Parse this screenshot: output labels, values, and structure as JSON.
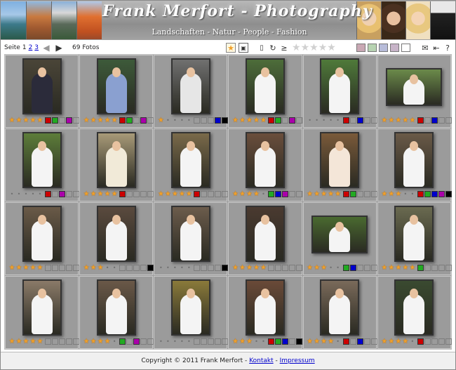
{
  "header": {
    "title": "Frank Merfort - Photography",
    "subtitle": "Landschaften - Natur - People - Fashion"
  },
  "toolbar": {
    "page_label": "Seite",
    "pages": [
      "1",
      "2",
      "3"
    ],
    "current_page": "1",
    "photo_count": "69 Fotos",
    "color_filters": [
      "#c9a8b4",
      "#b7d3b2",
      "#b7bcd9",
      "#c7b4c8",
      "#ffffff"
    ]
  },
  "cells": [
    {
      "orient": "portrait",
      "dress": "#2b2b3a",
      "bg": "#4a4538",
      "rating": 5,
      "squares": [
        "#cc0000",
        "#22aa22",
        "",
        "#aa00aa",
        ""
      ]
    },
    {
      "orient": "portrait",
      "dress": "#8aa0d0",
      "bg": "#3d5a3a",
      "rating": 5,
      "squares": [
        "#cc0000",
        "#22aa22",
        "",
        "#aa00aa",
        ""
      ]
    },
    {
      "orient": "portrait",
      "dress": "#e6e6e6",
      "bg": "#707070",
      "rating": 1,
      "squares": [
        "",
        "",
        "",
        "#0000cc",
        "#000000"
      ]
    },
    {
      "orient": "portrait",
      "dress": "#f4f4f4",
      "bg": "#4d6d3a",
      "rating": 5,
      "squares": [
        "#cc0000",
        "#22aa22",
        "",
        "#aa00aa",
        ""
      ]
    },
    {
      "orient": "portrait",
      "dress": "#f4f4f4",
      "bg": "#4f7a3a",
      "rating": 0,
      "squares": [
        "#cc0000",
        "",
        "#0000cc",
        "",
        ""
      ]
    },
    {
      "orient": "landscape",
      "dress": "#f4f4f4",
      "bg": "#6b8a4a",
      "rating": 5,
      "squares": [
        "#cc0000",
        "",
        "#0000cc",
        "",
        ""
      ]
    },
    {
      "orient": "portrait",
      "dress": "#f4f4f4",
      "bg": "#5d7d3a",
      "rating": 0,
      "squares": [
        "#cc0000",
        "",
        "#aa00aa",
        "",
        ""
      ]
    },
    {
      "orient": "portrait",
      "dress": "#f1ead8",
      "bg": "#a89a78",
      "rating": 5,
      "squares": [
        "#cc0000",
        "",
        "",
        "",
        ""
      ]
    },
    {
      "orient": "portrait",
      "dress": "#f4f4f4",
      "bg": "#7a6a4a",
      "rating": 5,
      "squares": [
        "#cc0000",
        "",
        "",
        "",
        ""
      ]
    },
    {
      "orient": "portrait",
      "dress": "#f4f4f4",
      "bg": "#6a4e3c",
      "rating": 4,
      "squares": [
        "#22aa22",
        "#0000cc",
        "#aa00aa",
        "",
        ""
      ]
    },
    {
      "orient": "portrait",
      "dress": "#f4e6d8",
      "bg": "#7a5a3a",
      "rating": 5,
      "squares": [
        "#cc0000",
        "#22aa22",
        "",
        "",
        ""
      ]
    },
    {
      "orient": "portrait",
      "dress": "#f4f4f4",
      "bg": "#6a5a48",
      "rating": 3,
      "squares": [
        "#cc0000",
        "#22aa22",
        "#0000cc",
        "#aa00aa",
        "#000000"
      ]
    },
    {
      "orient": "portrait",
      "dress": "#f4f4f4",
      "bg": "#6a5a48",
      "rating": 5,
      "squares": [
        "",
        "",
        "",
        "",
        ""
      ]
    },
    {
      "orient": "portrait",
      "dress": "#f4f4f4",
      "bg": "#5a4a3e",
      "rating": 3,
      "squares": [
        "",
        "",
        "",
        "",
        "#000000"
      ]
    },
    {
      "orient": "portrait",
      "dress": "#f4f4f4",
      "bg": "#6c5c4c",
      "rating": 0,
      "squares": [
        "",
        "",
        "",
        "",
        "#000000"
      ]
    },
    {
      "orient": "portrait",
      "dress": "#f4f4f4",
      "bg": "#4a3a30",
      "rating": 5,
      "squares": [
        "",
        "",
        "",
        "",
        ""
      ]
    },
    {
      "orient": "landscape",
      "dress": "#f4f4f4",
      "bg": "#4a6a30",
      "rating": 3,
      "squares": [
        "#22aa22",
        "#0000cc",
        "",
        "",
        ""
      ]
    },
    {
      "orient": "portrait",
      "dress": "#f4f4f4",
      "bg": "#6a6a50",
      "rating": 5,
      "squares": [
        "#22aa22",
        "",
        "",
        "",
        ""
      ]
    },
    {
      "orient": "portrait",
      "dress": "#f4f4f4",
      "bg": "#8a7a68",
      "rating": 5,
      "squares": [
        "",
        "",
        "",
        "",
        ""
      ]
    },
    {
      "orient": "portrait",
      "dress": "#f4f4f4",
      "bg": "#6a5848",
      "rating": 4,
      "squares": [
        "#22aa22",
        "",
        "#aa00aa",
        "",
        ""
      ]
    },
    {
      "orient": "portrait",
      "dress": "#f4f4f4",
      "bg": "#8a7a3a",
      "rating": 0,
      "squares": [
        "",
        "",
        "",
        "",
        ""
      ]
    },
    {
      "orient": "portrait",
      "dress": "#f4f4f4",
      "bg": "#6a4a38",
      "rating": 3,
      "squares": [
        "#cc0000",
        "#22aa22",
        "#0000cc",
        "",
        "#000000"
      ]
    },
    {
      "orient": "portrait",
      "dress": "#f4f4f4",
      "bg": "#7a6a5a",
      "rating": 4,
      "squares": [
        "#cc0000",
        "",
        "#0000cc",
        "",
        ""
      ]
    },
    {
      "orient": "portrait",
      "dress": "#f4f4f4",
      "bg": "#3a4a30",
      "rating": 4,
      "squares": [
        "#cc0000",
        "",
        "",
        "",
        ""
      ]
    }
  ],
  "footer": {
    "copyright": "Copyright © 2011 Frank Merfort -",
    "link_contact": "Kontakt",
    "separator": "-",
    "link_imprint": "Impressum"
  }
}
